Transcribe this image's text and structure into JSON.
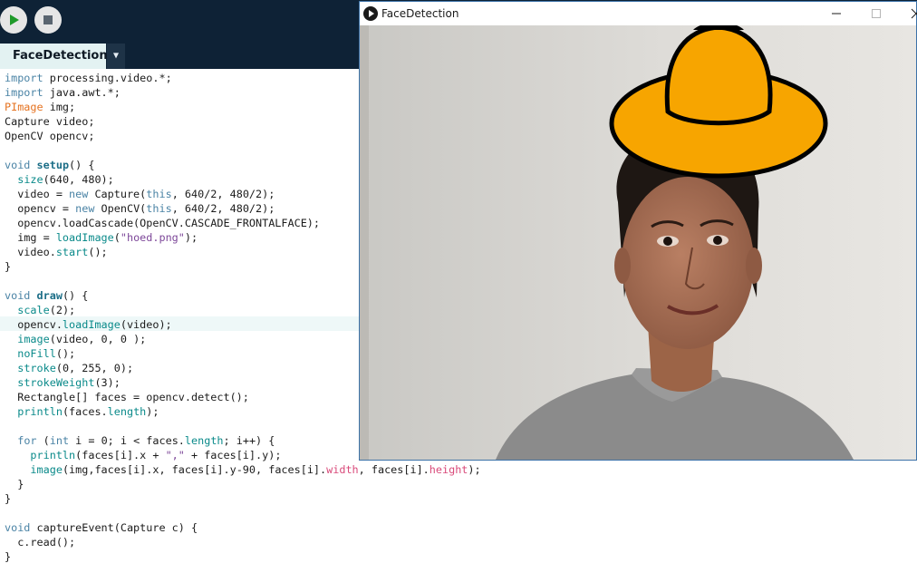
{
  "ide": {
    "toolbar": {
      "run_icon": "play-icon",
      "stop_icon": "stop-icon"
    },
    "tab": {
      "label": "FaceDetection",
      "menu_glyph": "▼"
    }
  },
  "sketch_window": {
    "title": "FaceDetection",
    "controls": {
      "minimize": "—",
      "maximize": "☐",
      "close": "✕"
    },
    "overlay": "hat-image"
  },
  "colors": {
    "toolbar_bg": "#0e2236",
    "run_green": "#1f9a2a",
    "keyword": "#4a83a5",
    "function": "#0a8a8a",
    "type": "#e57321",
    "string": "#7d4799",
    "property": "#d94a7a",
    "hat": "#f7a500"
  },
  "code": [
    "import processing.video.*;",
    "import java.awt.*;",
    "PImage img;",
    "Capture video;",
    "OpenCV opencv;",
    "",
    "void setup() {",
    "  size(640, 480);",
    "  video = new Capture(this, 640/2, 480/2);",
    "  opencv = new OpenCV(this, 640/2, 480/2);",
    "  opencv.loadCascade(OpenCV.CASCADE_FRONTALFACE);",
    "  img = loadImage(\"hoed.png\");",
    "  video.start();",
    "}",
    "",
    "void draw() {",
    "  scale(2);",
    "  opencv.loadImage(video);",
    "  image(video, 0, 0 );",
    "  noFill();",
    "  stroke(0, 255, 0);",
    "  strokeWeight(3);",
    "  Rectangle[] faces = opencv.detect();",
    "  println(faces.length);",
    "",
    "  for (int i = 0; i < faces.length; i++) {",
    "    println(faces[i].x + \",\" + faces[i].y);",
    "    image(img,faces[i].x, faces[i].y-90, faces[i].width, faces[i].height);",
    "  }",
    "}",
    "",
    "void captureEvent(Capture c) {",
    "  c.read();",
    "}"
  ]
}
